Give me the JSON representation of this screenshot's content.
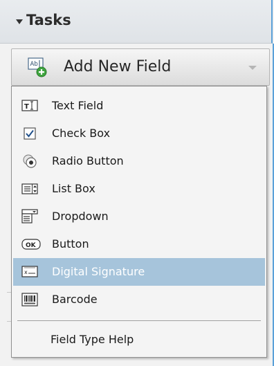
{
  "tasks": {
    "title": "Tasks"
  },
  "add_field": {
    "label": "Add New Field"
  },
  "menu": {
    "items": [
      {
        "label": "Text Field",
        "icon": "text-field-icon"
      },
      {
        "label": "Check Box",
        "icon": "check-box-icon"
      },
      {
        "label": "Radio Button",
        "icon": "radio-button-icon"
      },
      {
        "label": "List Box",
        "icon": "list-box-icon"
      },
      {
        "label": "Dropdown",
        "icon": "dropdown-icon"
      },
      {
        "label": "Button",
        "icon": "button-icon"
      },
      {
        "label": "Digital Signature",
        "icon": "digital-signature-icon",
        "highlighted": true
      },
      {
        "label": "Barcode",
        "icon": "barcode-icon"
      }
    ],
    "help_label": "Field Type Help"
  },
  "colors": {
    "highlight": "#a6c4db",
    "accent": "#5aa0d8"
  }
}
